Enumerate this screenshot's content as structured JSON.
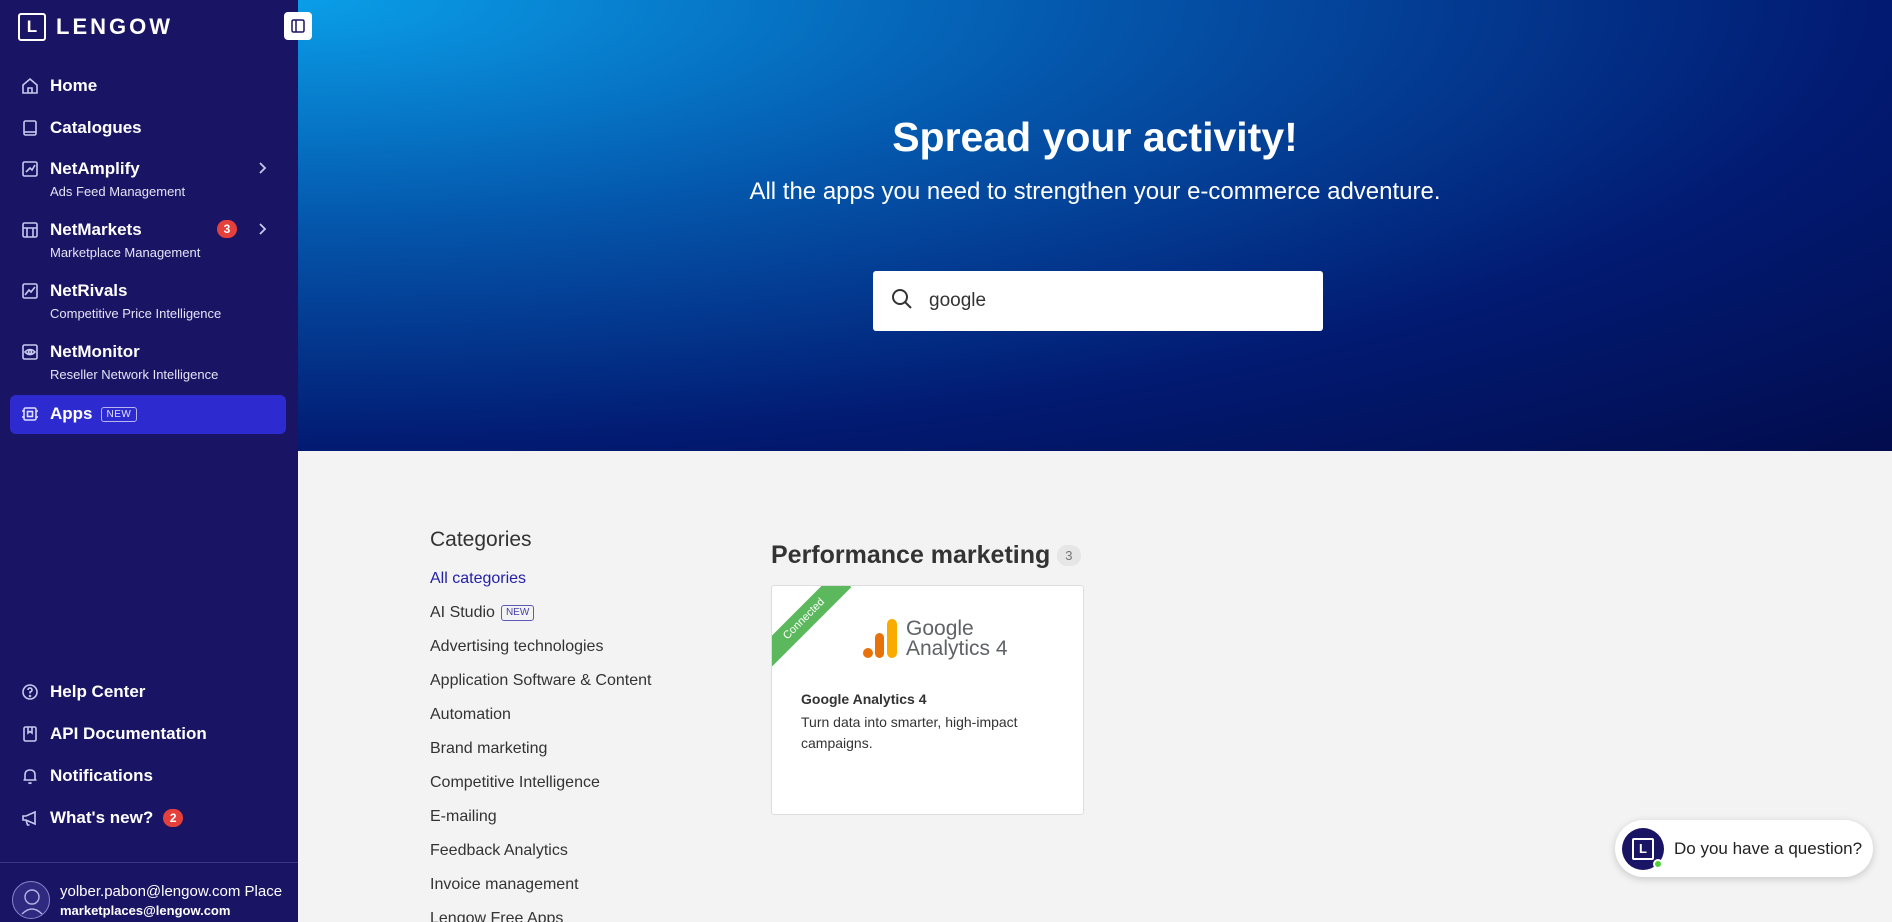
{
  "sidebar": {
    "logo_letter": "L",
    "logo_text": "LENGOW",
    "items": [
      {
        "label": "Home",
        "sub": ""
      },
      {
        "label": "Catalogues",
        "sub": ""
      },
      {
        "label": "NetAmplify",
        "sub": "Ads Feed Management"
      },
      {
        "label": "NetMarkets",
        "sub": "Marketplace Management",
        "badge": "3"
      },
      {
        "label": "NetRivals",
        "sub": "Competitive Price Intelligence"
      },
      {
        "label": "NetMonitor",
        "sub": "Reseller Network Intelligence"
      },
      {
        "label": "Apps",
        "sub": "",
        "tag": "NEW"
      }
    ],
    "bottom_items": [
      {
        "label": "Help Center"
      },
      {
        "label": "API Documentation"
      },
      {
        "label": "Notifications"
      },
      {
        "label": "What's new?",
        "badge": "2"
      }
    ],
    "user": {
      "email": "yolber.pabon@lengow.com Place",
      "account": "marketplaces@lengow.com"
    }
  },
  "hero": {
    "title": "Spread your activity!",
    "subtitle": "All the apps you need to strengthen your e-commerce adventure.",
    "search_value": "google"
  },
  "categories": {
    "title": "Categories",
    "items": [
      {
        "label": "All categories"
      },
      {
        "label": "AI Studio",
        "tag": "NEW"
      },
      {
        "label": "Advertising technologies"
      },
      {
        "label": "Application Software & Content"
      },
      {
        "label": "Automation"
      },
      {
        "label": "Brand marketing"
      },
      {
        "label": "Competitive Intelligence"
      },
      {
        "label": "E-mailing"
      },
      {
        "label": "Feedback Analytics"
      },
      {
        "label": "Invoice management"
      },
      {
        "label": "Lengow Free Apps"
      }
    ]
  },
  "section": {
    "title": "Performance marketing",
    "count": "3",
    "cards": [
      {
        "ribbon": "Connected",
        "logo_line1": "Google",
        "logo_line2": "Analytics 4",
        "name": "Google Analytics 4",
        "description": "Turn data into smarter, high-impact campaigns."
      }
    ]
  },
  "chat": {
    "avatar_letter": "L",
    "label": "Do you have a question?"
  },
  "colors": {
    "sidebar_bg": "#1a1464",
    "active_item": "#2d2bcf",
    "badge_red": "#e5403b",
    "link_blue": "#2320a8",
    "ribbon_green": "#5cb85c"
  }
}
